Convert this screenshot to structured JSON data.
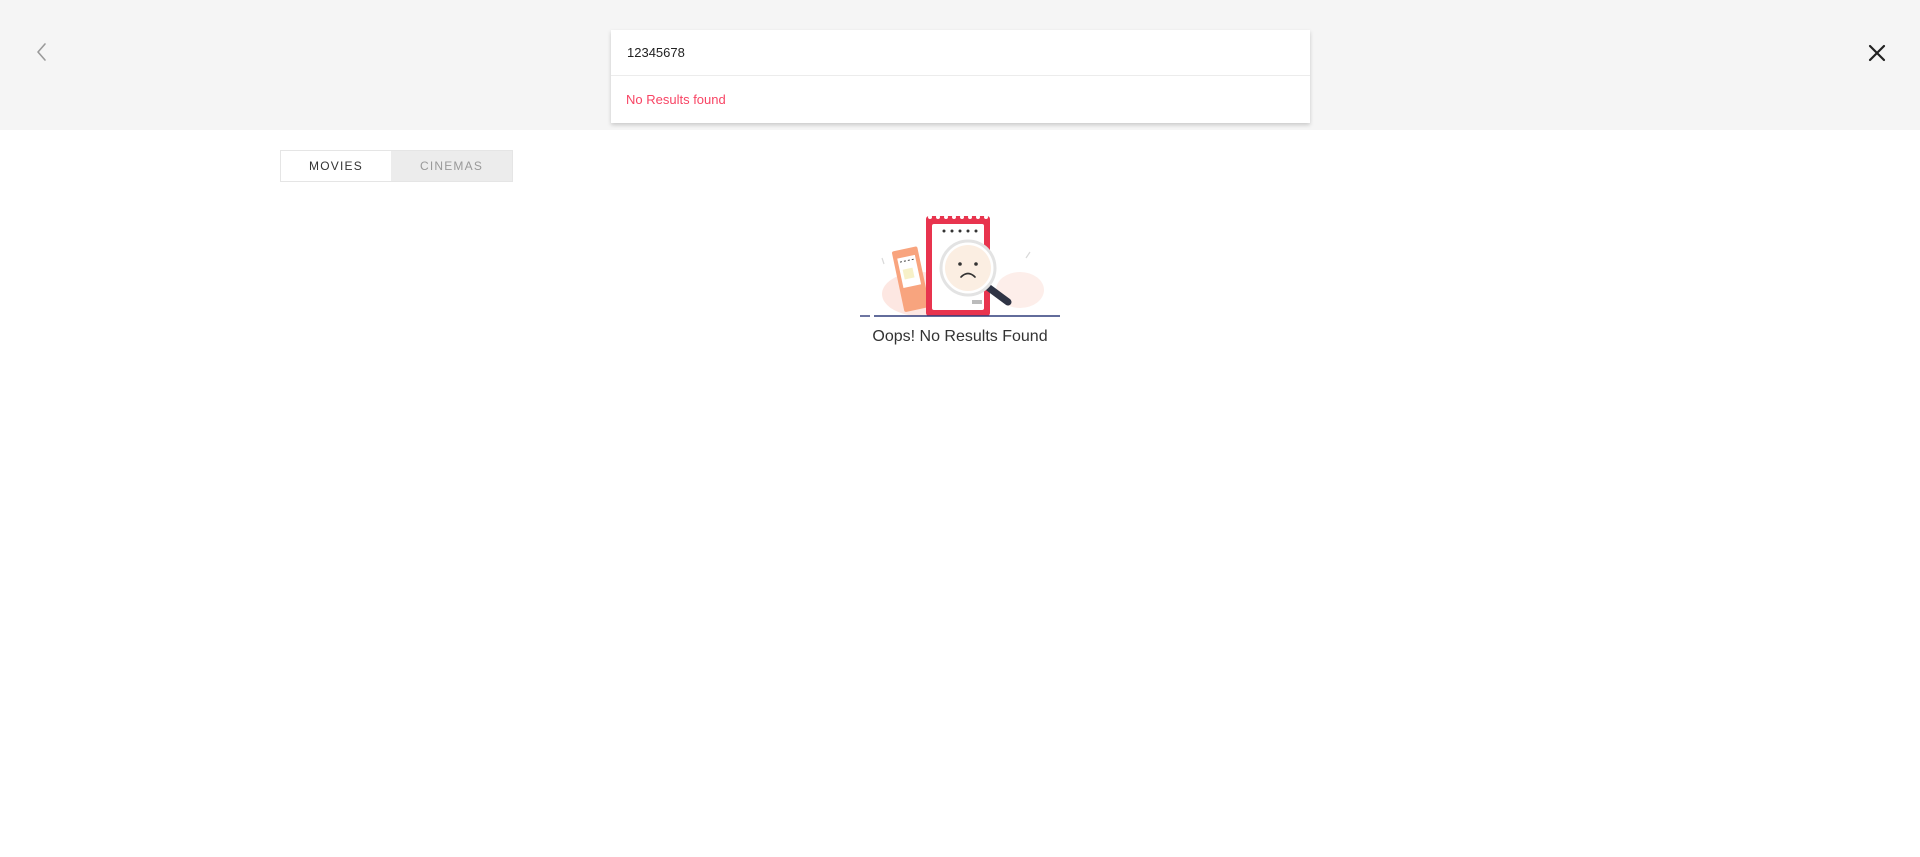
{
  "header": {
    "back_icon": "chevron-left-icon",
    "close_icon": "close-icon"
  },
  "search": {
    "value": "12345678",
    "placeholder": "",
    "dropdown_message": "No Results found"
  },
  "tabs": [
    {
      "label": "MOVIES",
      "active": true
    },
    {
      "label": "CINEMAS",
      "active": false
    }
  ],
  "empty_state": {
    "illustration": "ticket-magnifier-sad-face-illustration",
    "message": "Oops! No Results Found"
  },
  "colors": {
    "accent": "#f84464",
    "top_bar_bg": "#f5f5f5",
    "inactive_tab_bg": "#ececec"
  }
}
